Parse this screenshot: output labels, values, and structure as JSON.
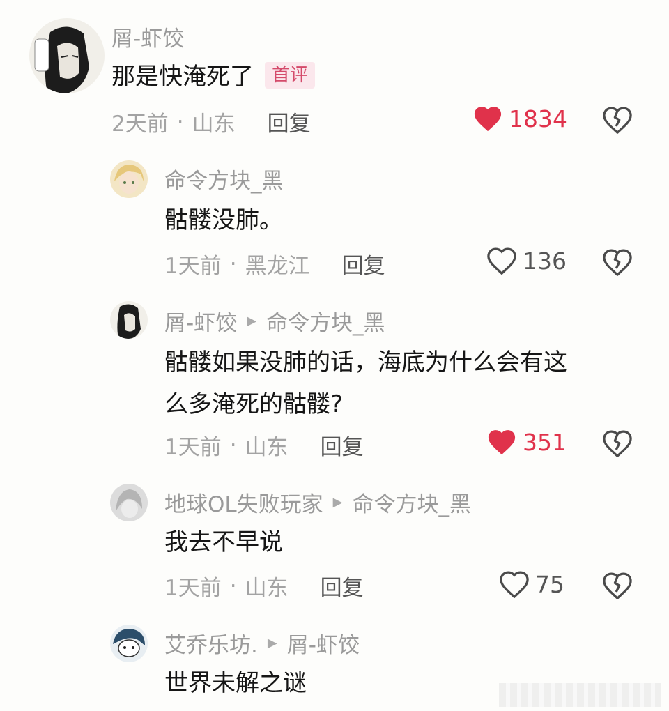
{
  "comments": [
    {
      "user": "屑-虾饺",
      "text": "那是快淹死了",
      "badge": "首评",
      "time": "2天前",
      "location": "山东",
      "reply_label": "回复",
      "likes": "1834",
      "liked": true
    },
    {
      "user": "命令方块_黑",
      "text": "骷髅没肺。",
      "time": "1天前",
      "location": "黑龙江",
      "reply_label": "回复",
      "likes": "136",
      "liked": false
    },
    {
      "user": "屑-虾饺",
      "reply_to": "命令方块_黑",
      "text_line1": "骷髅如果没肺的话，海底为什么会有这",
      "text_line2": "么多淹死的骷髅?",
      "time": "1天前",
      "location": "山东",
      "reply_label": "回复",
      "likes": "351",
      "liked": true
    },
    {
      "user": "地球OL失败玩家",
      "reply_to": "命令方块_黑",
      "text": "我去不早说",
      "time": "1天前",
      "location": "山东",
      "reply_label": "回复",
      "likes": "75",
      "liked": false
    },
    {
      "user": "艾乔乐坊.",
      "reply_to": "屑-虾饺",
      "text": "世界未解之谜"
    }
  ],
  "separator": "·",
  "colors": {
    "like_active": "#e0324b",
    "meta": "#a3a3a3",
    "username": "#9a9a9a",
    "badge": "#d44a6a"
  },
  "icons": [
    "heart-icon",
    "heart-outline-icon",
    "broken-heart-icon",
    "reply-arrow-icon"
  ]
}
